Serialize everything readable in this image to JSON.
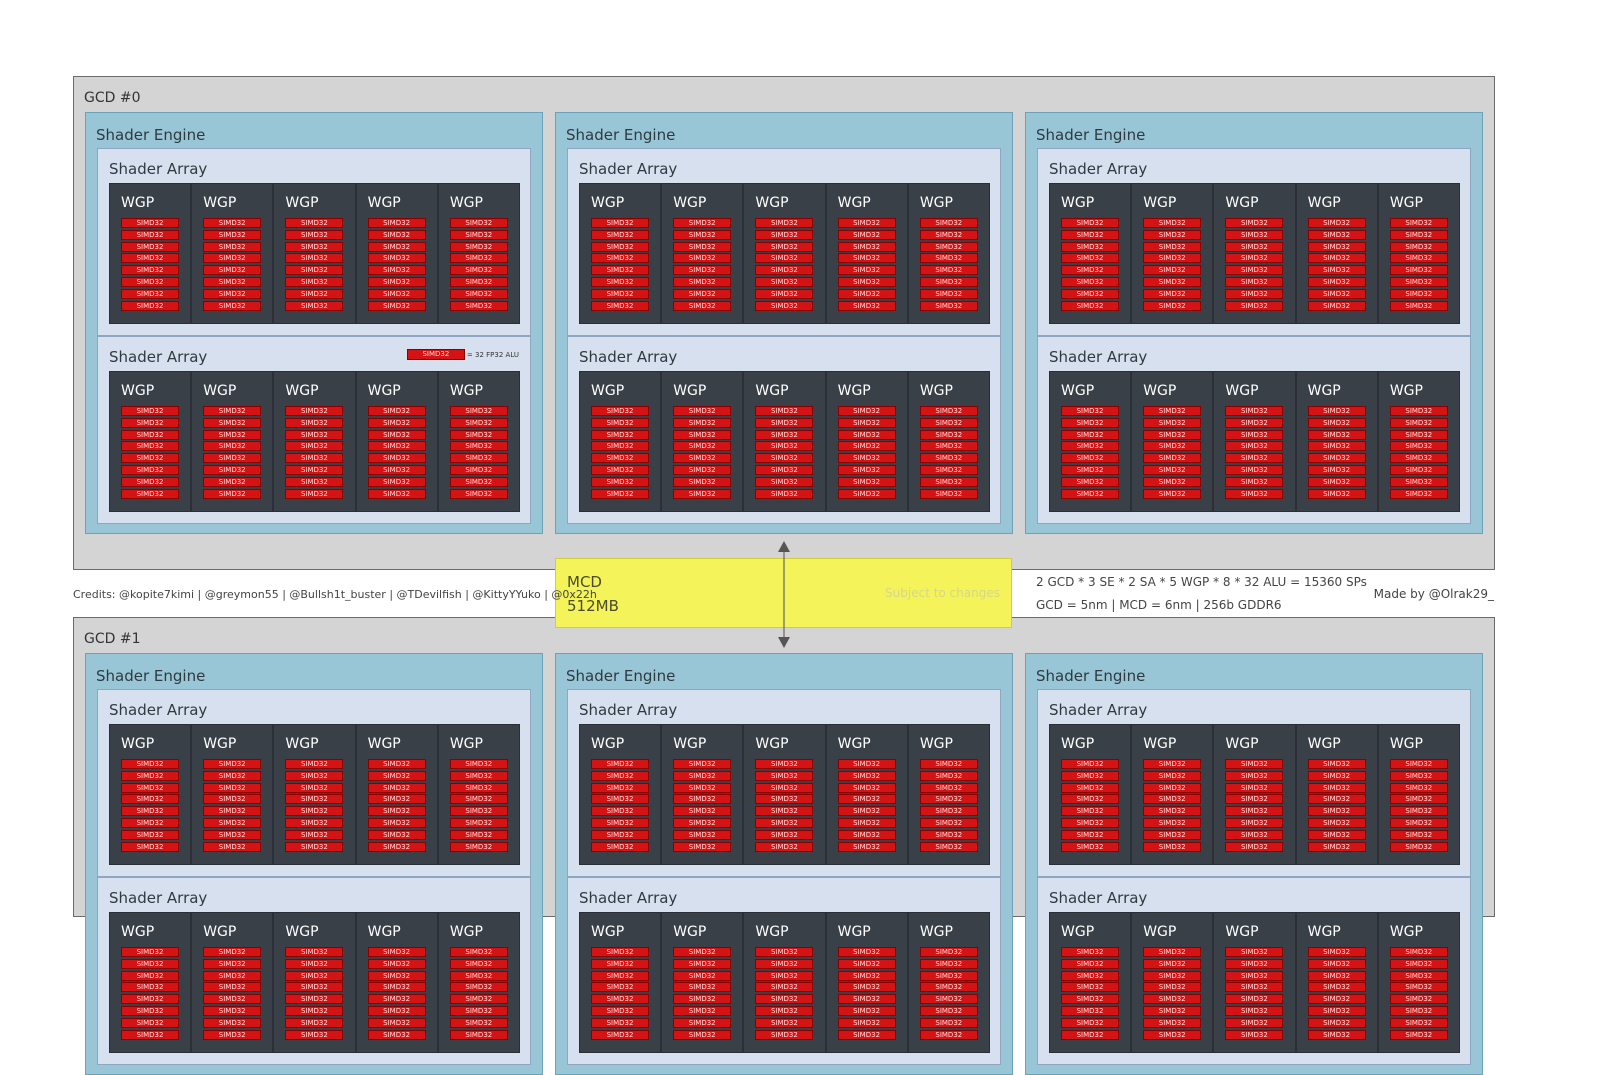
{
  "gcds": [
    {
      "label": "GCD #0"
    },
    {
      "label": "GCD #1"
    }
  ],
  "shader_engine_label": "Shader Engine",
  "shader_array_label": "Shader Array",
  "wgp_label": "WGP",
  "simd_label": "SIMD32",
  "simds_per_wgp": 8,
  "wgps_per_array": 5,
  "legend": {
    "swatch": "SIMD32",
    "text": "= 32 FP32 ALU"
  },
  "mcd": {
    "title": "MCD",
    "size": "512MB",
    "note": "Subject to changes"
  },
  "credits": "Credits: @kopite7kimi | @greymon55 | @Bullsh1t_buster | @TDevilfish | @KittyYYuko | @0x22h",
  "formula": "2 GCD * 3 SE * 2 SA * 5 WGP * 8 * 32 ALU = 15360 SPs",
  "process": "GCD = 5nm | MCD = 6nm | 256b GDDR6",
  "made_by": "Made by @Olrak29_",
  "colors": {
    "gcd": "#d4d4d4",
    "shader_engine": "#98c6d6",
    "shader_array": "#d7e0ee",
    "wgp": "#3a4048",
    "simd": "#d41414",
    "mcd": "#f4f45a"
  }
}
